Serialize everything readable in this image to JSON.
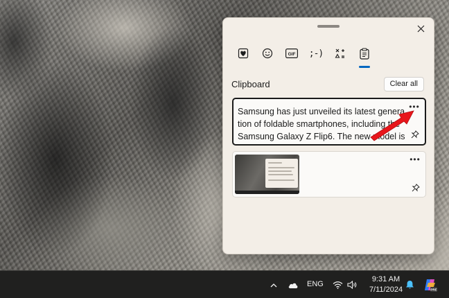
{
  "panel": {
    "tabs": [
      {
        "name": "emoji-hearts",
        "active": false
      },
      {
        "name": "emoji",
        "active": false
      },
      {
        "name": "gif",
        "label": "GIF",
        "active": false
      },
      {
        "name": "kaomoji",
        "label": ";-)",
        "active": false
      },
      {
        "name": "symbols",
        "active": false
      },
      {
        "name": "clipboard",
        "active": true
      }
    ],
    "section_title": "Clipboard",
    "clear_all": "Clear all",
    "items": [
      {
        "type": "text",
        "lines": [
          "Samsung has just unveiled its latest genera",
          "tion of foldable smartphones, including the",
          "Samsung Galaxy Z Flip6. The new model is"
        ],
        "selected": true
      },
      {
        "type": "image",
        "selected": false
      }
    ]
  },
  "taskbar": {
    "language": "ENG",
    "time": "9:31 AM",
    "date": "7/11/2024",
    "icons": [
      "chevron-up-icon",
      "cloud-icon",
      "wifi-icon",
      "volume-icon",
      "bell-icon",
      "copilot-icon"
    ]
  },
  "colors": {
    "accent": "#0067c0",
    "arrow": "#e8161b",
    "panel_bg": "#f3eee7",
    "taskbar_bg": "#20201f"
  }
}
